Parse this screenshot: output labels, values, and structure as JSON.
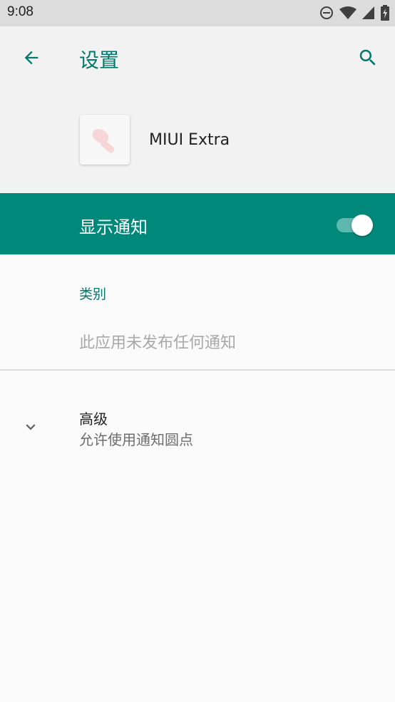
{
  "status_bar": {
    "time": "9:08",
    "icons": [
      "do-not-disturb-icon",
      "wifi-icon",
      "signal-icon",
      "battery-charging-icon"
    ]
  },
  "toolbar": {
    "title": "设置",
    "back_icon": "arrow-back-icon",
    "search_icon": "search-icon"
  },
  "app": {
    "name": "MIUI Extra"
  },
  "master_switch": {
    "label": "显示通知",
    "state": "on"
  },
  "categories": {
    "header": "类别",
    "empty_text": "此应用未发布任何通知"
  },
  "advanced": {
    "title": "高级",
    "summary": "允许使用通知圆点",
    "icon": "chevron-down-icon"
  },
  "colors": {
    "accent": "#00796b",
    "switch_bar": "#00897b",
    "header_background": "#f2f2f2",
    "page_background": "#fafafa"
  }
}
